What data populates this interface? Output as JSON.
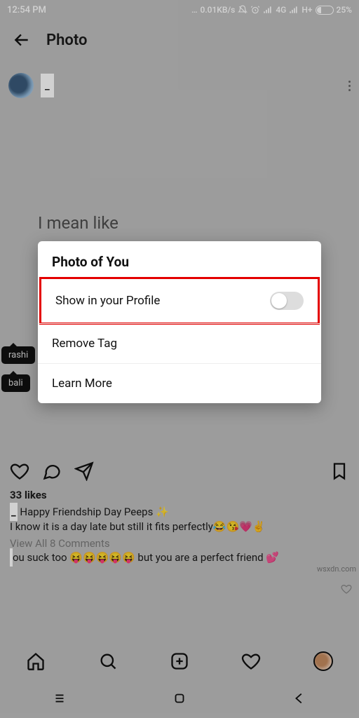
{
  "status": {
    "time": "12:54 PM",
    "speed": "0.01KB/s",
    "net1": "4G",
    "net2": "H+",
    "battery": "25%"
  },
  "header": {
    "title": "Photo"
  },
  "post": {
    "username_suffix": "_",
    "image_text": "I mean like",
    "tag1": "rashi",
    "tag2": "bali",
    "likes": "33 likes",
    "caption_user": "              _",
    "caption_line1": " Happy Friendship Day Peeps ✨",
    "caption_line2": "I know it is a day late but still it fits perfectly😂😘💗✌️",
    "view_comments": "View All 8 Comments",
    "comment_user": "              ",
    "comment_text": "ou suck too 😝😝😝😝😝 but you are a perfect friend 💕"
  },
  "dialog": {
    "title": "Photo of You",
    "row_show": "Show in your Profile",
    "row_remove": "Remove Tag",
    "row_learn": "Learn More"
  },
  "watermark": "wsxdn.com"
}
